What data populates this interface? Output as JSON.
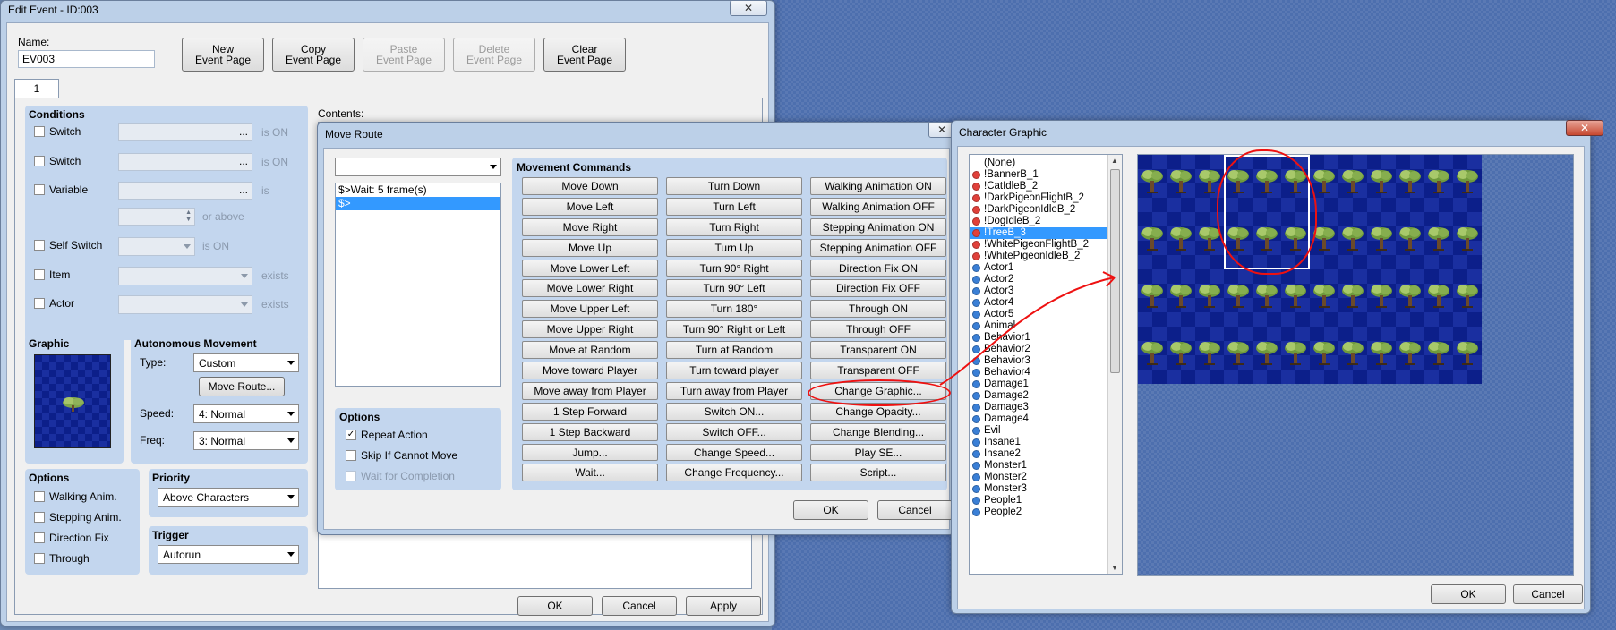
{
  "edit_event": {
    "title": "Edit Event - ID:003",
    "close_label": "✕",
    "name_label": "Name:",
    "name_value": "EV003",
    "buttons": {
      "new_page": [
        "New",
        "Event Page"
      ],
      "copy_page": [
        "Copy",
        "Event Page"
      ],
      "paste_page": [
        "Paste",
        "Event Page"
      ],
      "delete_page": [
        "Delete",
        "Event Page"
      ],
      "clear_page": [
        "Clear",
        "Event Page"
      ]
    },
    "tab_label": "1",
    "conditions": {
      "title": "Conditions",
      "switch1": "Switch",
      "switch2": "Switch",
      "variable": "Variable",
      "is_on": "is ON",
      "is": "is",
      "or_above": "or above",
      "self_switch": "Self Switch",
      "item": "Item",
      "actor": "Actor",
      "exists": "exists",
      "ellipsis": "..."
    },
    "graphic_title": "Graphic",
    "autonomous": {
      "title": "Autonomous Movement",
      "type_label": "Type:",
      "type_value": "Custom",
      "move_route_button": "Move Route...",
      "speed_label": "Speed:",
      "speed_value": "4: Normal",
      "freq_label": "Freq:",
      "freq_value": "3: Normal"
    },
    "options": {
      "title": "Options",
      "walking": "Walking Anim.",
      "stepping": "Stepping Anim.",
      "direction_fix": "Direction Fix",
      "through": "Through"
    },
    "priority": {
      "title": "Priority",
      "value": "Above Characters"
    },
    "trigger": {
      "title": "Trigger",
      "value": "Autorun"
    },
    "contents_label": "Contents:",
    "footer": {
      "ok": "OK",
      "cancel": "Cancel",
      "apply": "Apply"
    }
  },
  "move_route": {
    "title": "Move Route",
    "list": [
      "$>Wait: 5 frame(s)",
      "$>"
    ],
    "selected_index": 1,
    "options": {
      "title": "Options",
      "repeat": "Repeat Action",
      "repeat_checked": true,
      "skip": "Skip If Cannot Move",
      "skip_checked": false,
      "wait": "Wait for Completion"
    },
    "commands_title": "Movement Commands",
    "commands_col1": [
      "Move Down",
      "Move Left",
      "Move Right",
      "Move Up",
      "Move Lower Left",
      "Move Lower Right",
      "Move Upper Left",
      "Move Upper Right",
      "Move at Random",
      "Move toward Player",
      "Move away from Player",
      "1 Step Forward",
      "1 Step Backward",
      "Jump...",
      "Wait..."
    ],
    "commands_col2": [
      "Turn Down",
      "Turn Left",
      "Turn Right",
      "Turn Up",
      "Turn 90° Right",
      "Turn 90° Left",
      "Turn 180°",
      "Turn 90° Right or Left",
      "Turn at Random",
      "Turn toward player",
      "Turn away from Player",
      "Switch ON...",
      "Switch OFF...",
      "Change Speed...",
      "Change Frequency..."
    ],
    "commands_col3": [
      "Walking Animation ON",
      "Walking Animation OFF",
      "Stepping Animation ON",
      "Stepping Animation OFF",
      "Direction Fix ON",
      "Direction Fix OFF",
      "Through ON",
      "Through OFF",
      "Transparent ON",
      "Transparent OFF",
      "Change Graphic...",
      "Change Opacity...",
      "Change Blending...",
      "Play SE...",
      "Script..."
    ],
    "footer": {
      "ok": "OK",
      "cancel": "Cancel"
    }
  },
  "character_graphic": {
    "title": "Character Graphic",
    "close_label": "✕",
    "files": [
      {
        "name": "(None)",
        "color": ""
      },
      {
        "name": "!BannerB_1",
        "color": "#e0403a"
      },
      {
        "name": "!CatIdleB_2",
        "color": "#e0403a"
      },
      {
        "name": "!DarkPigeonFlightB_2",
        "color": "#e0403a"
      },
      {
        "name": "!DarkPigeonIdleB_2",
        "color": "#e0403a"
      },
      {
        "name": "!DogIdleB_2",
        "color": "#e0403a"
      },
      {
        "name": "!TreeB_3",
        "color": "#e0403a"
      },
      {
        "name": "!WhitePigeonFlightB_2",
        "color": "#e0403a"
      },
      {
        "name": "!WhitePigeonIdleB_2",
        "color": "#e0403a"
      },
      {
        "name": "Actor1",
        "color": "#3a7fd6"
      },
      {
        "name": "Actor2",
        "color": "#3a7fd6"
      },
      {
        "name": "Actor3",
        "color": "#3a7fd6"
      },
      {
        "name": "Actor4",
        "color": "#3a7fd6"
      },
      {
        "name": "Actor5",
        "color": "#3a7fd6"
      },
      {
        "name": "Animal",
        "color": "#3a7fd6"
      },
      {
        "name": "Behavior1",
        "color": "#3a7fd6"
      },
      {
        "name": "Behavior2",
        "color": "#3a7fd6"
      },
      {
        "name": "Behavior3",
        "color": "#3a7fd6"
      },
      {
        "name": "Behavior4",
        "color": "#3a7fd6"
      },
      {
        "name": "Damage1",
        "color": "#3a7fd6"
      },
      {
        "name": "Damage2",
        "color": "#3a7fd6"
      },
      {
        "name": "Damage3",
        "color": "#3a7fd6"
      },
      {
        "name": "Damage4",
        "color": "#3a7fd6"
      },
      {
        "name": "Evil",
        "color": "#3a7fd6"
      },
      {
        "name": "Insane1",
        "color": "#3a7fd6"
      },
      {
        "name": "Insane2",
        "color": "#3a7fd6"
      },
      {
        "name": "Monster1",
        "color": "#3a7fd6"
      },
      {
        "name": "Monster2",
        "color": "#3a7fd6"
      },
      {
        "name": "Monster3",
        "color": "#3a7fd6"
      },
      {
        "name": "People1",
        "color": "#3a7fd6"
      },
      {
        "name": "People2",
        "color": "#3a7fd6"
      }
    ],
    "selected_index": 6,
    "footer": {
      "ok": "OK",
      "cancel": "Cancel"
    }
  }
}
